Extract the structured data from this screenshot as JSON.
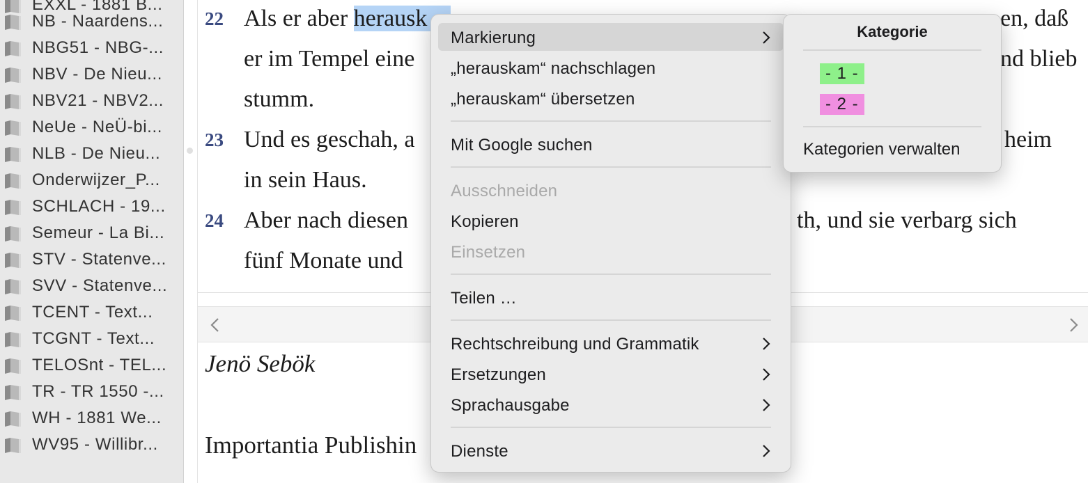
{
  "sidebar": {
    "items": [
      {
        "label": "EXXL - 1881 B..."
      },
      {
        "label": "NB - Naardens..."
      },
      {
        "label": "NBG51 - NBG-..."
      },
      {
        "label": "NBV - De Nieu..."
      },
      {
        "label": "NBV21 - NBV2..."
      },
      {
        "label": "NeUe - NeÜ-bi..."
      },
      {
        "label": "NLB - De Nieu..."
      },
      {
        "label": "Onderwijzer_P..."
      },
      {
        "label": "SCHLACH - 19..."
      },
      {
        "label": "Semeur - La Bi..."
      },
      {
        "label": "STV - Statenve..."
      },
      {
        "label": "SVV - Statenve..."
      },
      {
        "label": "TCENT - Text..."
      },
      {
        "label": "TCGNT - Text..."
      },
      {
        "label": "TELOSnt - TEL..."
      },
      {
        "label": "TR - TR 1550 -..."
      },
      {
        "label": "WH - 1881 We..."
      },
      {
        "label": "WV95 - Willibr..."
      }
    ]
  },
  "bible": {
    "verses": [
      {
        "num": "22",
        "lines": [
          "Als er aber herausk",
          "er im Tempel eine",
          "stumm."
        ],
        "right_fragments": [
          "en,  daß",
          "nd blieb"
        ]
      },
      {
        "num": "23",
        "lines": [
          "Und es geschah, a",
          "in sein Haus."
        ],
        "right_fragments": [
          "heim"
        ]
      },
      {
        "num": "24",
        "lines": [
          "Aber nach diesen",
          "fünf Monate und"
        ],
        "right_fragments": [
          "th, und sie verbarg sich"
        ]
      }
    ],
    "selected_word": "herausk"
  },
  "info": {
    "author": "Jenö Sebök",
    "publisher": "Importantia Publishin"
  },
  "context_menu": {
    "items": [
      {
        "label": "Markierung",
        "submenu": true,
        "active": true
      },
      {
        "label": "„herauskam“ nachschlagen"
      },
      {
        "label": "„herauskam“ übersetzen"
      },
      {
        "label": "Mit Google suchen"
      },
      {
        "label": "Ausschneiden",
        "disabled": true
      },
      {
        "label": "Kopieren"
      },
      {
        "label": "Einsetzen",
        "disabled": true
      },
      {
        "label": "Teilen …"
      },
      {
        "label": "Rechtschreibung und Grammatik",
        "submenu": true
      },
      {
        "label": "Ersetzungen",
        "submenu": true
      },
      {
        "label": "Sprachausgabe",
        "submenu": true
      },
      {
        "label": "Dienste",
        "submenu": true
      }
    ]
  },
  "submenu": {
    "title": "Kategorie",
    "categories": [
      {
        "label": "- 1 -",
        "color": "#8ef08a"
      },
      {
        "label": "- 2 -",
        "color": "#f08fe0"
      }
    ],
    "manage_label": "Kategorien verwalten"
  },
  "colors": {
    "selection": "#b5d4f6",
    "verse_number": "#3a4a80",
    "menu_bg": "#ebebeb",
    "menu_active": "#d6d6d6"
  }
}
